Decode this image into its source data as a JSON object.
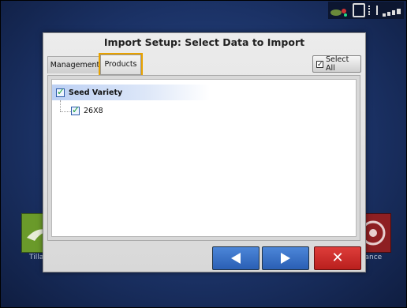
{
  "dialog": {
    "title": "Import Setup: Select Data to Import",
    "tabs": [
      {
        "label": "Management",
        "active": false
      },
      {
        "label": "Products",
        "active": true
      }
    ],
    "select_all_label": "Select All",
    "select_all_checked": true,
    "tree": {
      "root": {
        "label": "Seed Variety",
        "checked": true
      },
      "children": [
        {
          "label": "26X8",
          "checked": true
        }
      ]
    },
    "buttons": {
      "previous_icon": "arrow-left-icon",
      "next_icon": "arrow-right-icon",
      "cancel_icon": "close-icon"
    }
  },
  "background": {
    "left_tile_label": "Tilla",
    "right_tile_label": "lance"
  },
  "colors": {
    "accent_highlight": "#e8a200",
    "nav_button": "#3a72c8",
    "cancel_button": "#cc2b29",
    "checkbox_check": "#1da23a"
  }
}
